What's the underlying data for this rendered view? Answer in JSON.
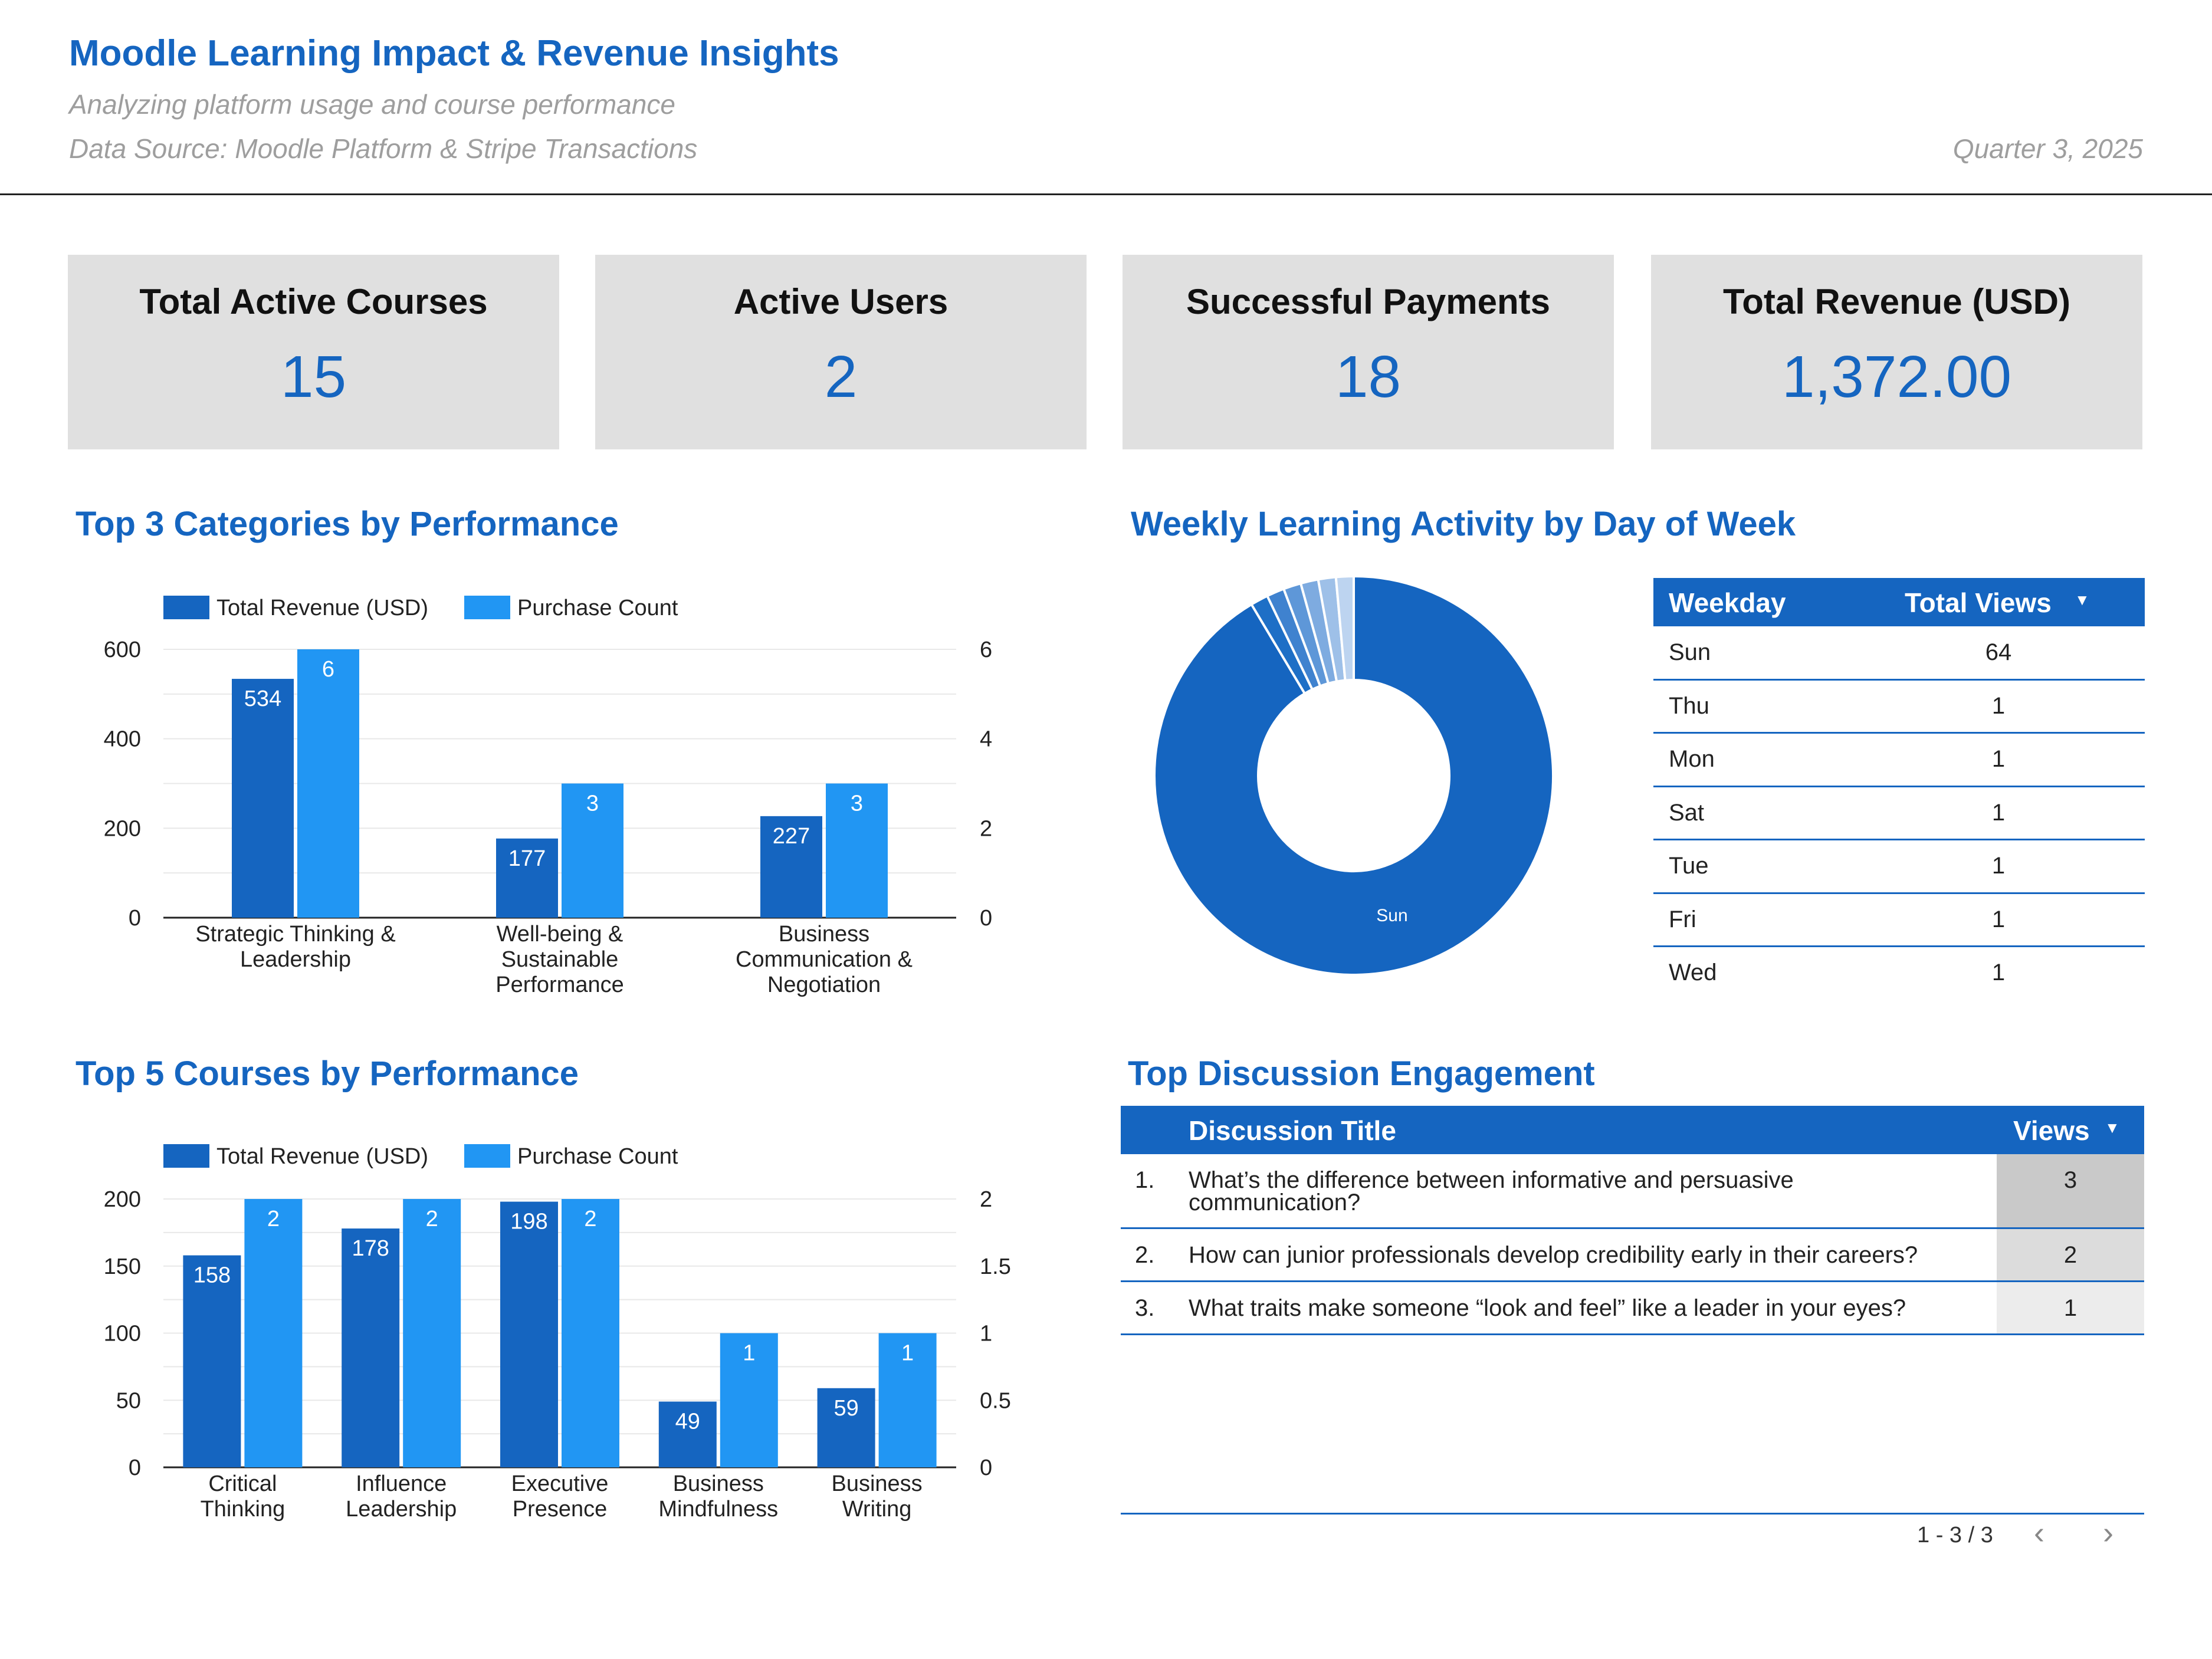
{
  "header": {
    "title": "Moodle Learning Impact & Revenue Insights",
    "subtitle": "Analyzing platform usage and course performance",
    "data_source": "Data Source: Moodle Platform & Stripe Transactions",
    "period": "Quarter 3, 2025"
  },
  "kpis": [
    {
      "label": "Total Active Courses",
      "value": "15"
    },
    {
      "label": "Active Users",
      "value": "2"
    },
    {
      "label": "Successful Payments",
      "value": "18"
    },
    {
      "label": "Total Revenue (USD)",
      "value": "1,372.00"
    }
  ],
  "colors": {
    "primary": "#1565c0",
    "secondary": "#2196f3",
    "kpi_bg": "#e0e0e0",
    "header_text": "#1565c0"
  },
  "sections": {
    "top_categories": "Top 3 Categories by Performance",
    "weekly_activity": "Weekly Learning Activity by Day of Week",
    "top_courses": "Top 5 Courses by Performance",
    "discussion": "Top Discussion Engagement"
  },
  "chart_data": [
    {
      "type": "bar",
      "title": "Top 3 Categories by Performance",
      "categories": [
        [
          "Strategic Thinking &",
          "Leadership"
        ],
        [
          "Well-being &",
          "Sustainable",
          "Performance"
        ],
        [
          "Business",
          "Communication &",
          "Negotiation"
        ]
      ],
      "series": [
        {
          "name": "Total Revenue (USD)",
          "axis": "left",
          "values": [
            534,
            177,
            227
          ],
          "labels": [
            "534",
            "177",
            "227"
          ]
        },
        {
          "name": "Purchase Count",
          "axis": "right",
          "values": [
            6,
            3,
            3
          ],
          "labels": [
            "6",
            "3",
            "3"
          ]
        }
      ],
      "ylim_left": [
        0,
        600
      ],
      "yticks_left": [
        "0",
        "200",
        "400",
        "600"
      ],
      "ylim_right": [
        0,
        6
      ],
      "yticks_right": [
        "0",
        "2",
        "4",
        "6"
      ],
      "legend": "top-left",
      "grid": true
    },
    {
      "type": "bar",
      "title": "Top 5 Courses by Performance",
      "categories": [
        [
          "Critical",
          "Thinking"
        ],
        [
          "Influence",
          "Leadership"
        ],
        [
          "Executive",
          "Presence"
        ],
        [
          "Business",
          "Mindfulness"
        ],
        [
          "Business",
          "Writing"
        ]
      ],
      "series": [
        {
          "name": "Total Revenue (USD)",
          "axis": "left",
          "values": [
            158,
            178,
            198,
            49,
            59
          ],
          "labels": [
            "158",
            "178",
            "198",
            "49",
            "59"
          ]
        },
        {
          "name": "Purchase Count",
          "axis": "right",
          "values": [
            2,
            2,
            2,
            1,
            1
          ],
          "labels": [
            "2",
            "2",
            "2",
            "1",
            "1"
          ]
        }
      ],
      "ylim_left": [
        0,
        200
      ],
      "yticks_left": [
        "0",
        "50",
        "100",
        "150",
        "200"
      ],
      "ylim_right": [
        0,
        2
      ],
      "yticks_right": [
        "0",
        "0.5",
        "1",
        "1.5",
        "2"
      ],
      "legend": "top-left",
      "grid": true
    },
    {
      "type": "pie",
      "title": "Weekly Learning Activity by Day of Week",
      "donut": true,
      "labels": [
        "Sun",
        "Thu",
        "Mon",
        "Sat",
        "Tue",
        "Fri",
        "Wed"
      ],
      "values": [
        64,
        1,
        1,
        1,
        1,
        1,
        1
      ],
      "colors": [
        "#1565c0",
        "#1e6fc6",
        "#3f82cf",
        "#5e97d8",
        "#7eabe0",
        "#9ec0e8",
        "#bdd4f0"
      ],
      "slice_label": "Sun"
    }
  ],
  "weekday_table": {
    "headers": [
      "Weekday",
      "Total Views"
    ],
    "sort_indicator": "▼",
    "rows": [
      [
        "Sun",
        "64"
      ],
      [
        "Thu",
        "1"
      ],
      [
        "Mon",
        "1"
      ],
      [
        "Sat",
        "1"
      ],
      [
        "Tue",
        "1"
      ],
      [
        "Fri",
        "1"
      ],
      [
        "Wed",
        "1"
      ]
    ]
  },
  "discussion_table": {
    "headers": [
      "Discussion Title",
      "Views"
    ],
    "sort_indicator": "▼",
    "rows": [
      {
        "index": "1.",
        "title_lines": [
          "What’s the difference between informative and persuasive",
          "communication?"
        ],
        "views": "3"
      },
      {
        "index": "2.",
        "title_lines": [
          "How can junior professionals develop credibility early in their careers?"
        ],
        "views": "2"
      },
      {
        "index": "3.",
        "title_lines": [
          "What traits make someone “look and feel” like a leader in your eyes?"
        ],
        "views": "1"
      }
    ],
    "pagination": "1 - 3 / 3"
  }
}
